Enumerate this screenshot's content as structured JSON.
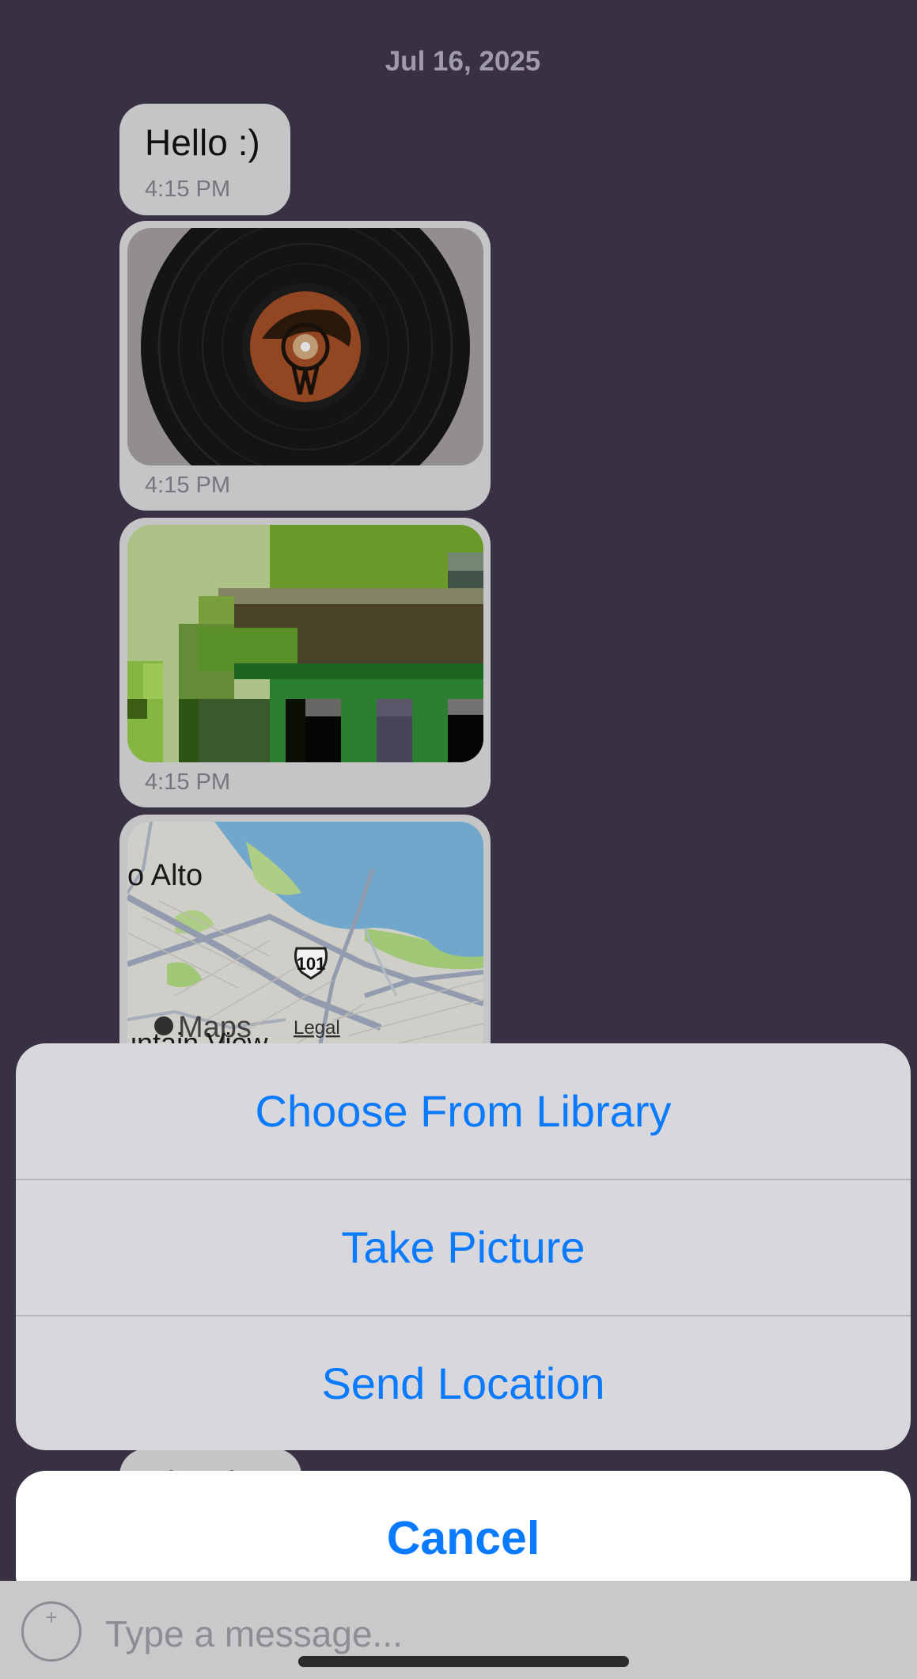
{
  "conversation": {
    "date_header": "Jul 16, 2025",
    "messages": [
      {
        "type": "text",
        "text": "Hello :)",
        "time": "4:15 PM"
      },
      {
        "type": "image",
        "image": "vinyl-record-photo",
        "time": "4:15 PM"
      },
      {
        "type": "image",
        "image": "pixel-art-image",
        "time": "4:15 PM"
      },
      {
        "type": "location",
        "map": {
          "labels": [
            "o Alto",
            "101",
            "Maps",
            "untain View",
            "Legal"
          ]
        }
      },
      {
        "type": "text",
        "text": "Thanks!"
      }
    ]
  },
  "action_sheet": {
    "options": [
      "Choose From Library",
      "Take Picture",
      "Send Location"
    ],
    "cancel_label": "Cancel"
  },
  "composer": {
    "placeholder": "Type a message...",
    "add_symbol": "+"
  },
  "colors": {
    "background": "#3a3447",
    "bubble": "#d0d0d2",
    "accent": "#0a7aff",
    "sheet": "#d8d7dc"
  }
}
